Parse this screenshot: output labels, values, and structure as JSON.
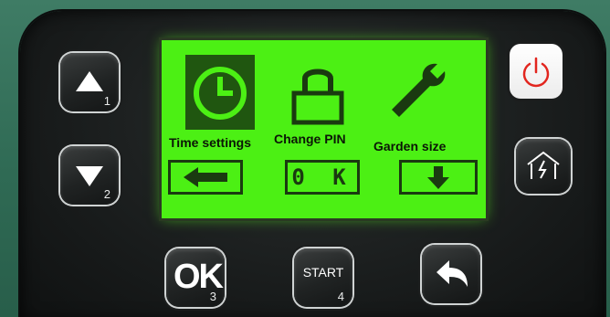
{
  "keys": {
    "up": {
      "num": "1"
    },
    "down": {
      "num": "2"
    },
    "ok": {
      "label": "OK",
      "num": "3"
    },
    "start": {
      "label": "START",
      "num": "4"
    }
  },
  "screen": {
    "menu": [
      {
        "label": "Time settings",
        "icon": "clock-icon",
        "selected": true
      },
      {
        "label": "Change PIN",
        "icon": "padlock-icon",
        "selected": false
      },
      {
        "label": "Garden size",
        "icon": "wrench-icon",
        "selected": false
      }
    ],
    "softkeys": {
      "left_icon": "arrow-left-icon",
      "center": "0 K",
      "right_icon": "arrow-down-icon"
    }
  },
  "colors": {
    "lcd": "#4cf014",
    "lcd_dark": "#1a3a10",
    "power": "#e2261f"
  }
}
